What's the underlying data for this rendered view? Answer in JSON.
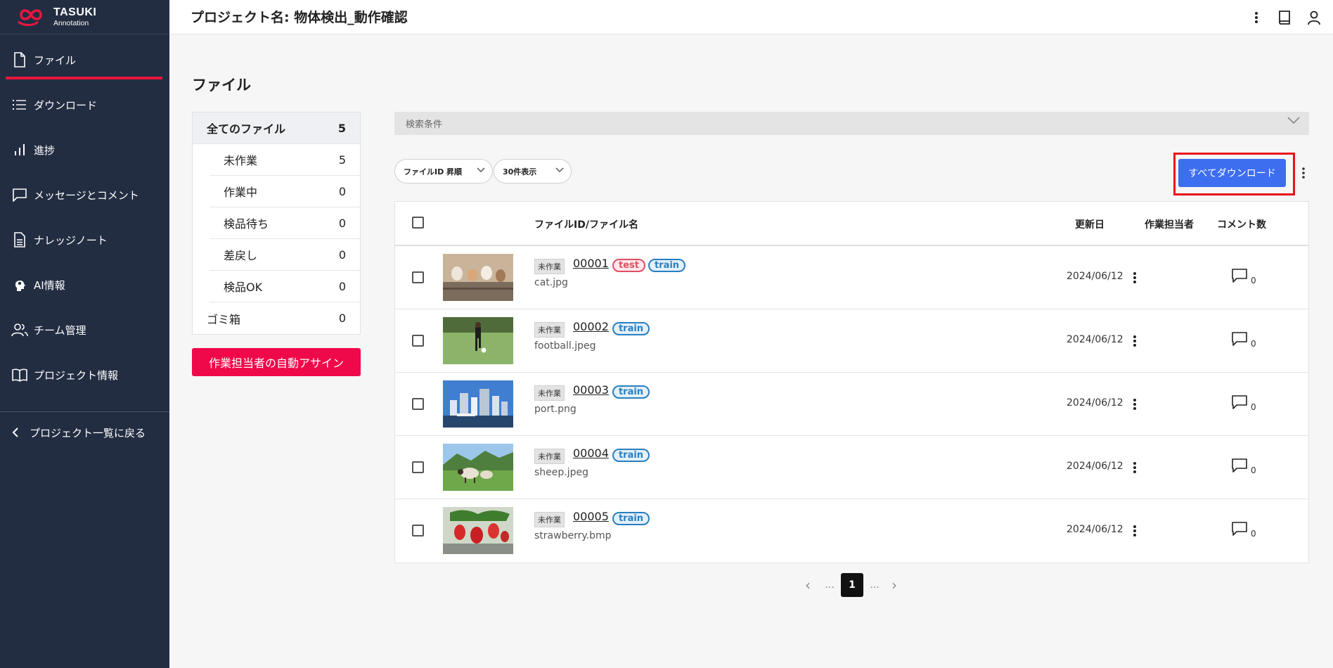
{
  "app": {
    "logo_main": "TASUKI",
    "logo_sub": "Annotation",
    "accent_color": "#e8173e",
    "sidebar_bg": "#232d42"
  },
  "header": {
    "title": "プロジェクト名: 物体検出_動作確認",
    "icons": [
      "more-vertical-icon",
      "book-icon",
      "user-icon"
    ]
  },
  "sidebar": {
    "items": [
      {
        "label": "ファイル",
        "icon": "file-icon",
        "active": true
      },
      {
        "label": "ダウンロード",
        "icon": "list-icon"
      },
      {
        "label": "進捗",
        "icon": "bar-chart-icon"
      },
      {
        "label": "メッセージとコメント",
        "icon": "message-icon"
      },
      {
        "label": "ナレッジノート",
        "icon": "document-icon"
      },
      {
        "label": "AI情報",
        "icon": "ai-head-icon"
      },
      {
        "label": "チーム管理",
        "icon": "team-icon"
      },
      {
        "label": "プロジェクト情報",
        "icon": "open-book-icon"
      }
    ],
    "back_label": "プロジェクト一覧に戻る"
  },
  "main": {
    "page_title": "ファイル",
    "categories": {
      "all": {
        "label": "全てのファイル",
        "count": "5"
      },
      "subs": [
        {
          "label": "未作業",
          "count": "5"
        },
        {
          "label": "作業中",
          "count": "0"
        },
        {
          "label": "検品待ち",
          "count": "0"
        },
        {
          "label": "差戻し",
          "count": "0"
        },
        {
          "label": "検品OK",
          "count": "0"
        }
      ],
      "trash": {
        "label": "ゴミ箱",
        "count": "0"
      }
    },
    "assign_button": "作業担当者の自動アサイン",
    "search_label": "検索条件",
    "sort_select": "ファイルID 昇順",
    "per_page_select": "30件表示",
    "download_all_button": "すべてダウンロード",
    "table": {
      "headers": {
        "file": "ファイルID/ファイル名",
        "updated": "更新日",
        "assignee": "作業担当者",
        "comments": "コメント数"
      },
      "rows": [
        {
          "status": "未作業",
          "id": "00001",
          "tags": [
            "test",
            "train"
          ],
          "name": "cat.jpg",
          "date": "2024/06/12",
          "comments": "0"
        },
        {
          "status": "未作業",
          "id": "00002",
          "tags": [
            "train"
          ],
          "name": "football.jpeg",
          "date": "2024/06/12",
          "comments": "0"
        },
        {
          "status": "未作業",
          "id": "00003",
          "tags": [
            "train"
          ],
          "name": "port.png",
          "date": "2024/06/12",
          "comments": "0"
        },
        {
          "status": "未作業",
          "id": "00004",
          "tags": [
            "train"
          ],
          "name": "sheep.jpeg",
          "date": "2024/06/12",
          "comments": "0"
        },
        {
          "status": "未作業",
          "id": "00005",
          "tags": [
            "train"
          ],
          "name": "strawberry.bmp",
          "date": "2024/06/12",
          "comments": "0"
        }
      ]
    },
    "pagination": {
      "prev": "‹",
      "ellipsis": "...",
      "current": "1",
      "next": "›"
    }
  }
}
